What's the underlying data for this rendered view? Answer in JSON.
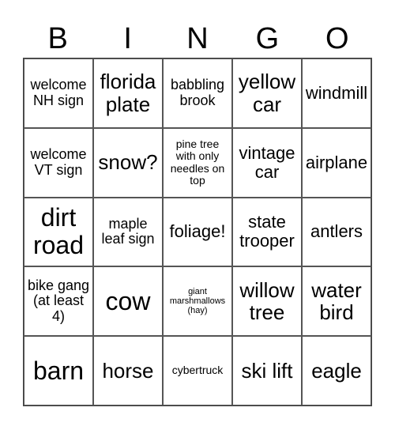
{
  "header": [
    "B",
    "I",
    "N",
    "G",
    "O"
  ],
  "cells": [
    {
      "text": "welcome NH sign",
      "size": "m"
    },
    {
      "text": "florida plate",
      "size": "xl"
    },
    {
      "text": "babbling brook",
      "size": "m"
    },
    {
      "text": "yellow car",
      "size": "xl"
    },
    {
      "text": "windmill",
      "size": "l"
    },
    {
      "text": "welcome VT sign",
      "size": "m"
    },
    {
      "text": "snow?",
      "size": "xl"
    },
    {
      "text": "pine tree with only needles on top",
      "size": "s"
    },
    {
      "text": "vintage car",
      "size": "l"
    },
    {
      "text": "airplane",
      "size": "l"
    },
    {
      "text": "dirt road",
      "size": "xxl"
    },
    {
      "text": "maple leaf sign",
      "size": "m"
    },
    {
      "text": "foliage!",
      "size": "l"
    },
    {
      "text": "state trooper",
      "size": "l"
    },
    {
      "text": "antlers",
      "size": "l"
    },
    {
      "text": "bike gang (at least 4)",
      "size": "m"
    },
    {
      "text": "cow",
      "size": "xxl"
    },
    {
      "text": "giant marshmallows (hay)",
      "size": "xs"
    },
    {
      "text": "willow tree",
      "size": "xl"
    },
    {
      "text": "water bird",
      "size": "xl"
    },
    {
      "text": "barn",
      "size": "xxl"
    },
    {
      "text": "horse",
      "size": "xl"
    },
    {
      "text": "cybertruck",
      "size": "s"
    },
    {
      "text": "ski lift",
      "size": "xl"
    },
    {
      "text": "eagle",
      "size": "xl"
    }
  ]
}
